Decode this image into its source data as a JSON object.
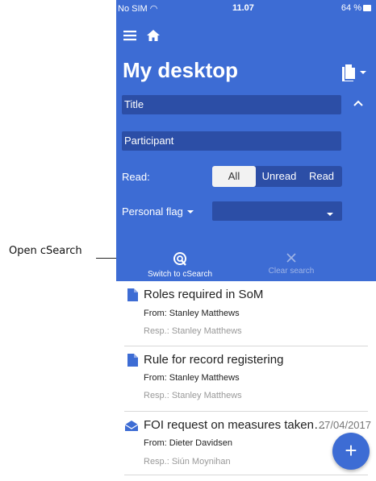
{
  "callout": {
    "label": "Open cSearch"
  },
  "status_bar": {
    "carrier": "No SIM",
    "time": "11.07",
    "battery": "64 %"
  },
  "header": {
    "title": "My desktop",
    "title_field_placeholder": "Title",
    "participant_field_placeholder": "Participant",
    "read_label": "Read:",
    "read_options": [
      "All",
      "Unread",
      "Read"
    ],
    "read_selected": "All",
    "personal_flag_label": "Personal flag",
    "actions": {
      "switch_label": "Switch to cSearch",
      "clear_label": "Clear search"
    }
  },
  "records": [
    {
      "title": "Roles required in SoM",
      "from": "From: Stanley Matthews",
      "resp": "Resp.: Stanley Matthews",
      "date": "",
      "icon": "document-icon"
    },
    {
      "title": "Rule for record registering",
      "from": "From: Stanley Matthews",
      "resp": "Resp.: Stanley Matthews",
      "date": "",
      "icon": "document-icon"
    },
    {
      "title": "FOI request on measures taken…",
      "from": "From: Dieter Davidsen",
      "resp": "Resp.: Siún Moynihan",
      "date": "27/04/2017",
      "icon": "envelope-icon"
    }
  ],
  "fab": {
    "label": "+"
  },
  "colors": {
    "accent": "#3d6cd4",
    "field": "#2c4ea6"
  }
}
